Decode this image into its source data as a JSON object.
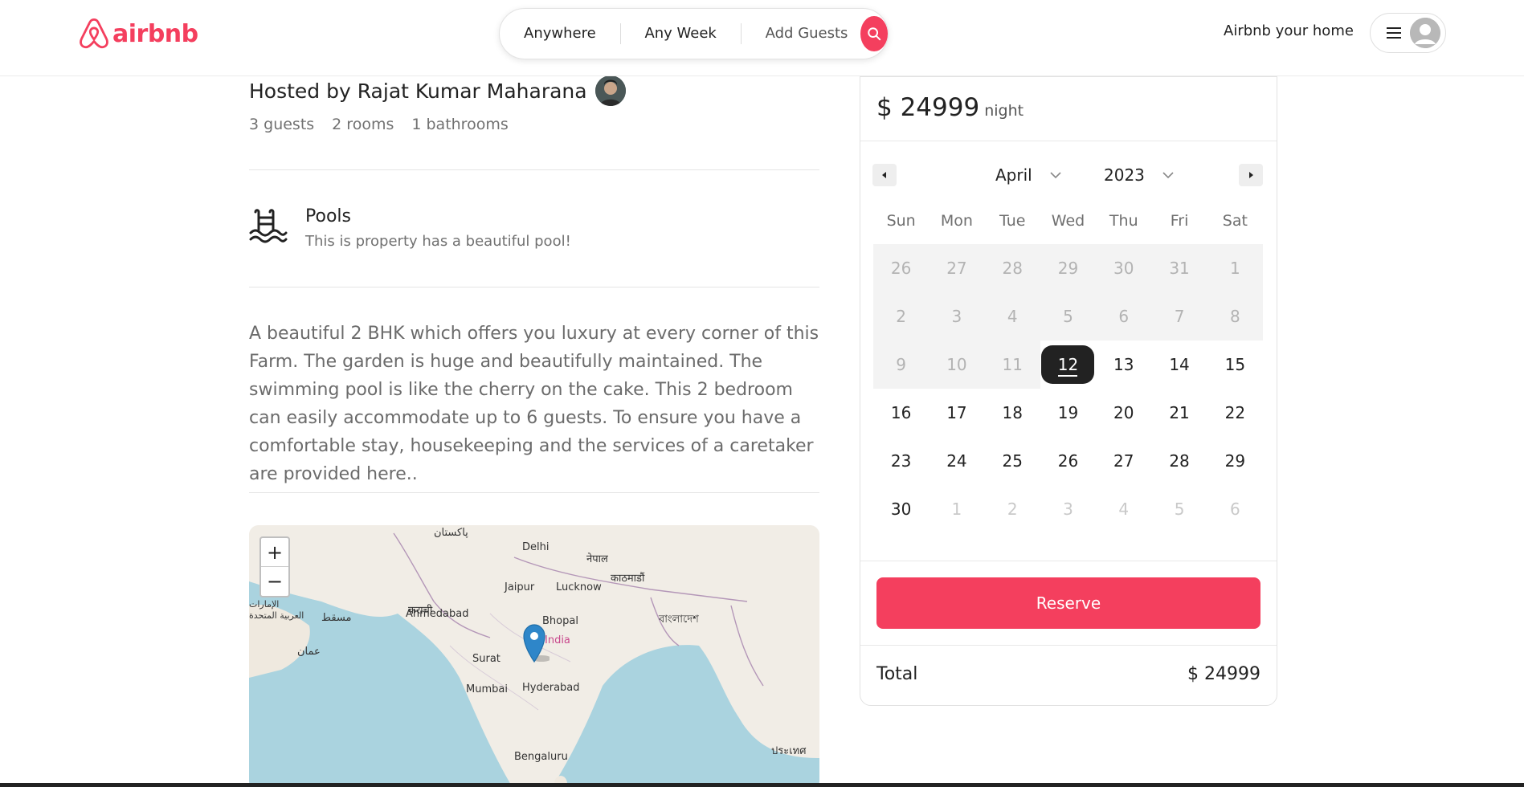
{
  "header": {
    "logo_text": "airbnb",
    "search": {
      "location": "Anywhere",
      "week": "Any Week",
      "guests": "Add Guests"
    },
    "host_link": "Airbnb your home",
    "brand_color": "#f43f5e"
  },
  "listing": {
    "host_title": "Hosted by Rajat Kumar Maharana",
    "stats": [
      "3 guests",
      "2 rooms",
      "1 bathrooms"
    ],
    "amenity": {
      "icon": "pool-icon",
      "title": "Pools",
      "description": "This is property has a beautiful pool!"
    },
    "description": "A beautiful 2 BHK which offers you luxury at every corner of this Farm. The garden is huge and beautifully maintained. The swimming pool is like the cherry on the cake. This 2 bedroom can easily accommodate up to 6 guests. To ensure you have a comfortable stay, housekeeping and the services of a caretaker are provided here.."
  },
  "map": {
    "zoom_in": "+",
    "zoom_out": "−",
    "labels": [
      "Delhi",
      "Jaipur",
      "Lucknow",
      "Ahmedabad",
      "Bhopal",
      "India",
      "Surat",
      "Mumbai",
      "Hyderabad",
      "Bengaluru",
      "پاکستان",
      "कराची",
      "مسقط",
      "नेपाल",
      "काठमाडौं",
      "বাংলাদেশ",
      "عمان",
      "الإمارات العربية المتحدة",
      "ประเทศ"
    ]
  },
  "booking": {
    "price": "$ 24999",
    "price_unit": "night",
    "calendar": {
      "month": "April",
      "year": "2023",
      "weekdays": [
        "Sun",
        "Mon",
        "Tue",
        "Wed",
        "Thu",
        "Fri",
        "Sat"
      ],
      "days": [
        {
          "n": "26",
          "state": "past"
        },
        {
          "n": "27",
          "state": "past"
        },
        {
          "n": "28",
          "state": "past"
        },
        {
          "n": "29",
          "state": "past"
        },
        {
          "n": "30",
          "state": "past"
        },
        {
          "n": "31",
          "state": "past"
        },
        {
          "n": "1",
          "state": "past"
        },
        {
          "n": "2",
          "state": "past"
        },
        {
          "n": "3",
          "state": "past"
        },
        {
          "n": "4",
          "state": "past"
        },
        {
          "n": "5",
          "state": "past"
        },
        {
          "n": "6",
          "state": "past"
        },
        {
          "n": "7",
          "state": "past"
        },
        {
          "n": "8",
          "state": "past"
        },
        {
          "n": "9",
          "state": "past"
        },
        {
          "n": "10",
          "state": "past"
        },
        {
          "n": "11",
          "state": "past"
        },
        {
          "n": "12",
          "state": "selected"
        },
        {
          "n": "13",
          "state": "normal"
        },
        {
          "n": "14",
          "state": "normal"
        },
        {
          "n": "15",
          "state": "normal"
        },
        {
          "n": "16",
          "state": "normal"
        },
        {
          "n": "17",
          "state": "normal"
        },
        {
          "n": "18",
          "state": "normal"
        },
        {
          "n": "19",
          "state": "normal"
        },
        {
          "n": "20",
          "state": "normal"
        },
        {
          "n": "21",
          "state": "normal"
        },
        {
          "n": "22",
          "state": "normal"
        },
        {
          "n": "23",
          "state": "normal"
        },
        {
          "n": "24",
          "state": "normal"
        },
        {
          "n": "25",
          "state": "normal"
        },
        {
          "n": "26",
          "state": "normal"
        },
        {
          "n": "27",
          "state": "normal"
        },
        {
          "n": "28",
          "state": "normal"
        },
        {
          "n": "29",
          "state": "normal"
        },
        {
          "n": "30",
          "state": "normal"
        },
        {
          "n": "1",
          "state": "other"
        },
        {
          "n": "2",
          "state": "other"
        },
        {
          "n": "3",
          "state": "other"
        },
        {
          "n": "4",
          "state": "other"
        },
        {
          "n": "5",
          "state": "other"
        },
        {
          "n": "6",
          "state": "other"
        }
      ]
    },
    "reserve_label": "Reserve",
    "total_label": "Total",
    "total_value": "$ 24999"
  }
}
